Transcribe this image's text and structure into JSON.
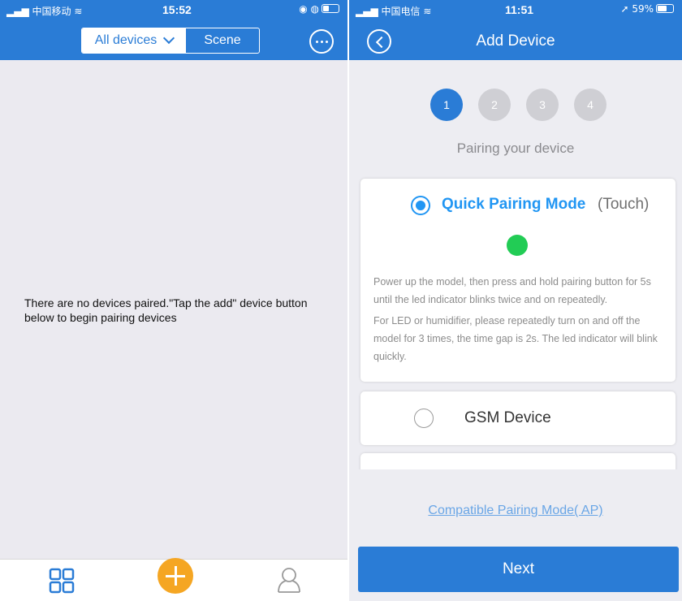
{
  "left": {
    "status": {
      "carrier": "中国移动",
      "time": "15:52"
    },
    "segmented": {
      "all_devices": "All devices",
      "scene": "Scene"
    },
    "empty_message": "There are no devices paired.\"Tap the add\" device button below to begin pairing devices",
    "tabbar": {
      "icons": [
        "grid-icon",
        "add-icon",
        "user-icon"
      ]
    }
  },
  "right": {
    "status": {
      "carrier": "中国电信",
      "time": "11:51",
      "battery": "59%"
    },
    "header": {
      "title": "Add Device"
    },
    "steps": [
      "1",
      "2",
      "3",
      "4"
    ],
    "active_step": 1,
    "pairing_title": "Pairing your device",
    "options": {
      "quick": {
        "label": "Quick Pairing Mode",
        "sub": "(Touch)",
        "selected": true,
        "desc1": "Power up the model, then press and hold pairing button for 5s until the led indicator blinks twice and on repeatedly.",
        "desc2": "For LED or humidifier, please repeatedly turn on and off the model for 3 times, the time gap is 2s. The led indicator will blink quickly."
      },
      "gsm": {
        "label": "GSM Device",
        "selected": false
      }
    },
    "compat_link": "Compatible Pairing Mode( AP)",
    "next_button": "Next"
  },
  "colors": {
    "primary": "#2a7cd6",
    "accent": "#2196f3",
    "fab": "#f5a623",
    "led": "#22cc55"
  }
}
